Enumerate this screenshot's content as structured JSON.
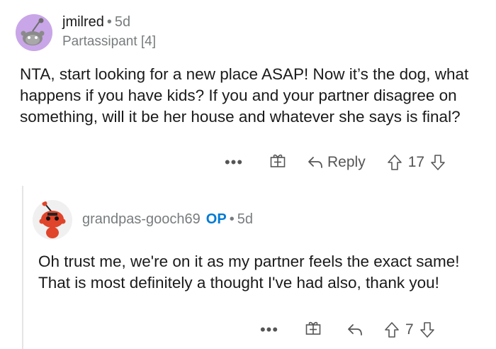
{
  "comment": {
    "username": "jmilred",
    "separator": "•",
    "age": "5d",
    "flair": "Partassipant [4]",
    "body": "NTA, start looking for a new place ASAP!  Now it’s the dog, what happens if you have kids?  If you and your partner disagree on something, will it be her house and whatever she says is final?",
    "actions": {
      "more": "•••",
      "reply_label": "Reply",
      "vote_count": "17"
    }
  },
  "reply": {
    "username": "grandpas-gooch69",
    "op_badge": "OP",
    "separator": "•",
    "age": "5d",
    "body": "Oh trust me, we're on it as my partner feels the exact same! That is most definitely a thought I've had also, thank you!",
    "actions": {
      "more": "•••",
      "vote_count": "7"
    }
  },
  "colors": {
    "avatar1_bg": "#c9a6e8",
    "avatar2_body": "#e0442a",
    "op_badge": "#0079d3",
    "meta_gray": "#787c7e"
  }
}
